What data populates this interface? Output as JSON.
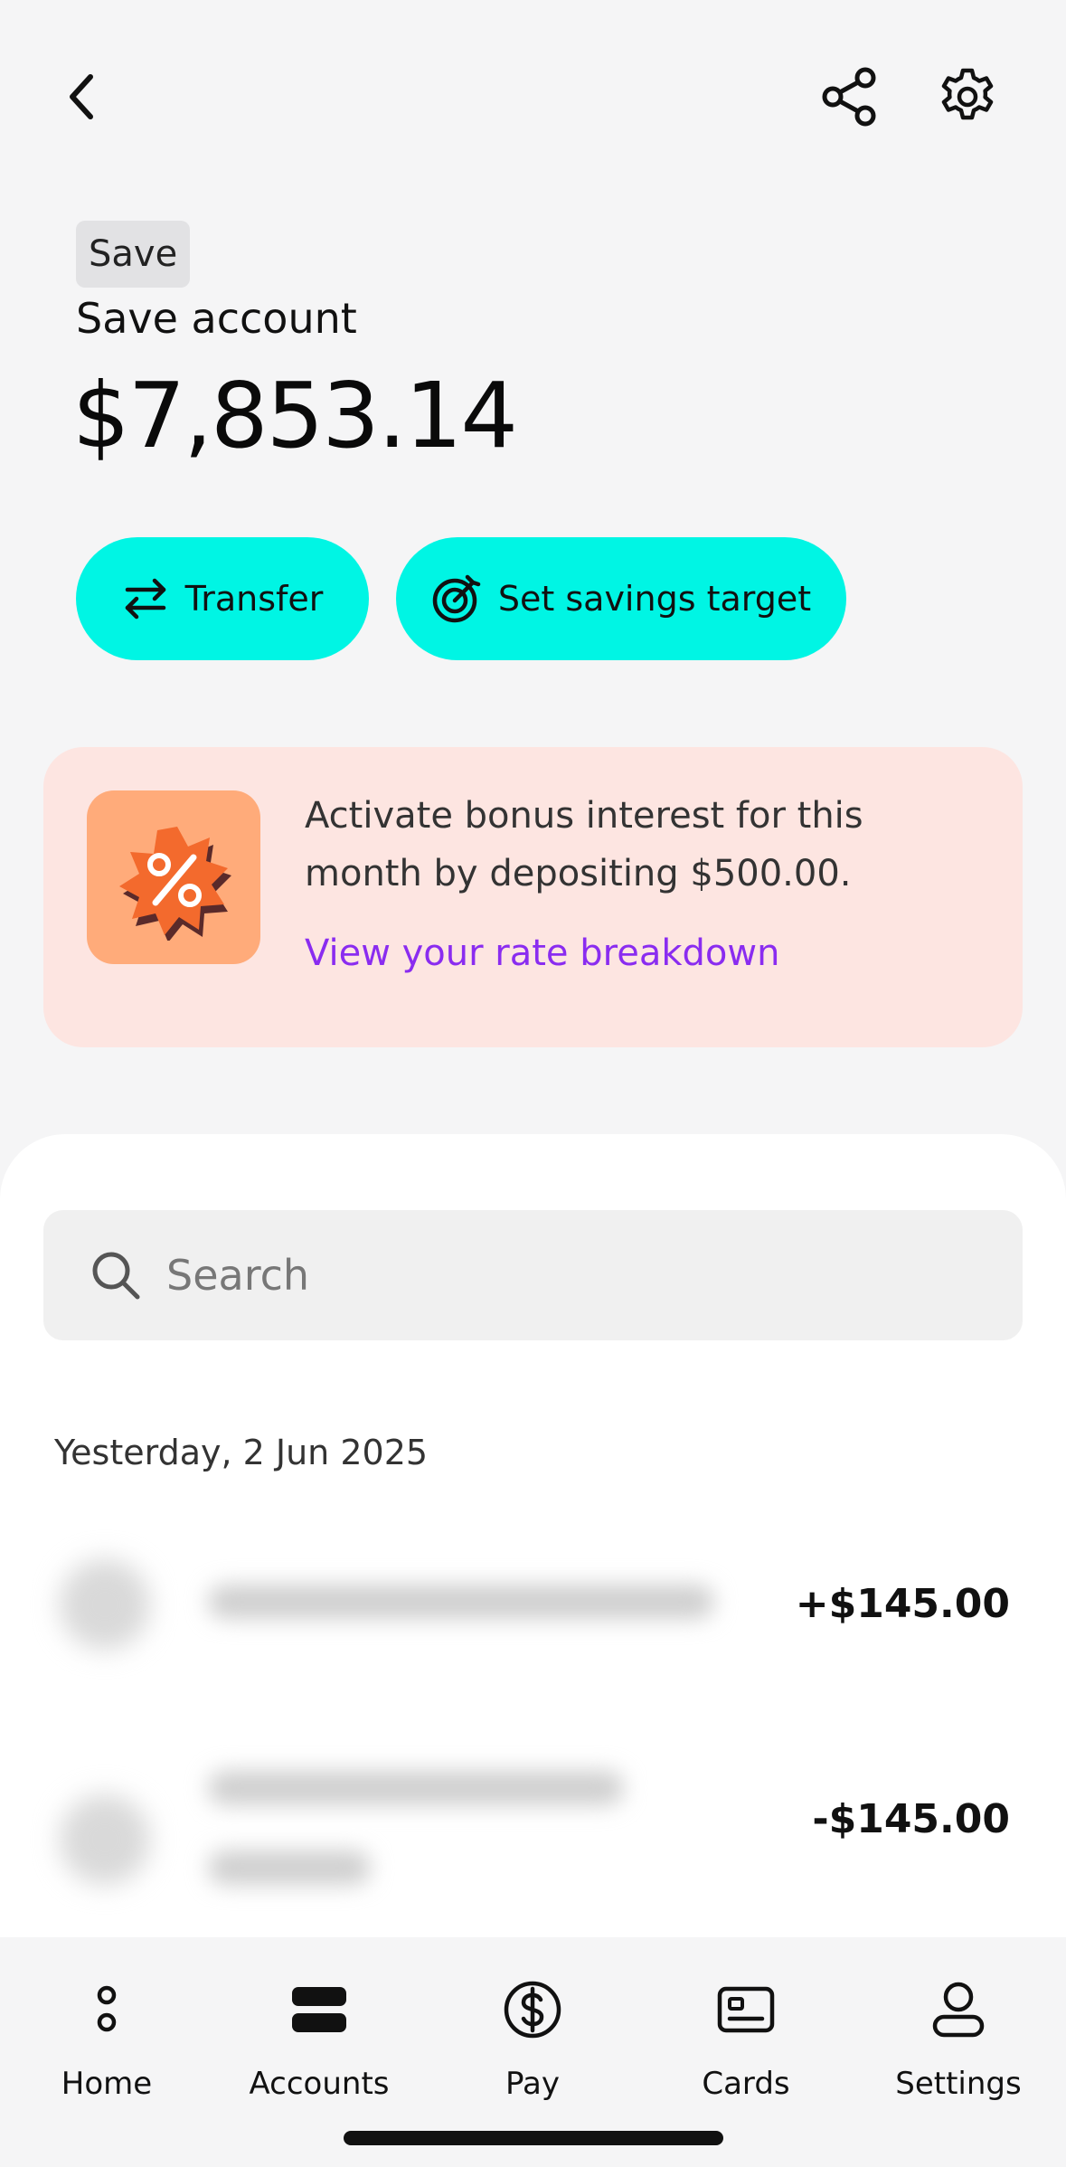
{
  "header": {
    "back_icon": "chevron-left-icon",
    "share_icon": "share-icon",
    "settings_icon": "gear-icon"
  },
  "account": {
    "tag": "Save",
    "name": "Save account",
    "balance": "$7,853.14"
  },
  "actions": {
    "transfer_label": "Transfer",
    "target_label": "Set savings target"
  },
  "promo": {
    "text": "Activate bonus interest for this month by depositing $500.00.",
    "link": "View your rate breakdown",
    "badge_icon": "percent-badge-icon"
  },
  "search": {
    "placeholder": "Search"
  },
  "transactions": {
    "date_header": "Yesterday, 2 Jun 2025",
    "items": [
      {
        "amount": "+$145.00"
      },
      {
        "amount": "-$145.00"
      }
    ]
  },
  "tabs": [
    {
      "label": "Home"
    },
    {
      "label": "Accounts"
    },
    {
      "label": "Pay"
    },
    {
      "label": "Cards"
    },
    {
      "label": "Settings"
    }
  ],
  "colors": {
    "accent": "#00f5e4",
    "link": "#8a2cf0",
    "promo_bg": "#fde5e1",
    "badge_bg": "#ffab7a"
  }
}
